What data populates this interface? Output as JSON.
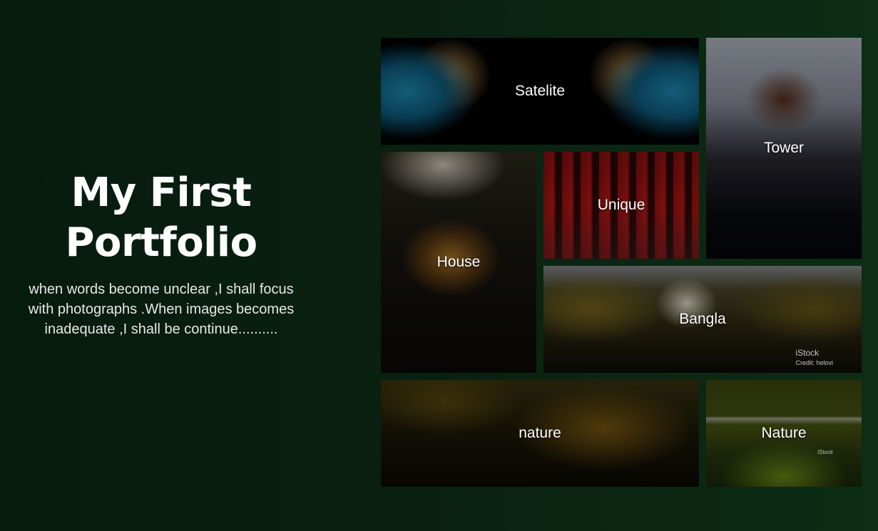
{
  "intro": {
    "title": "My First Portfolio",
    "description": "when words become unclear ,I shall focus with photographs .When images becomes inadequate ,I shall be continue.........."
  },
  "gallery": {
    "tiles": [
      {
        "label": "Satelite"
      },
      {
        "label": "Tower"
      },
      {
        "label": "House"
      },
      {
        "label": "Unique"
      },
      {
        "label": "Bangla",
        "watermark": "iStock",
        "watermark_credit": "Credit: helovi"
      },
      {
        "label": "nature"
      },
      {
        "label": "Nature",
        "watermark": "iStock"
      }
    ]
  },
  "colors": {
    "background_start": "#071a0e",
    "background_end": "#0d2d14",
    "text": "#ffffff"
  }
}
